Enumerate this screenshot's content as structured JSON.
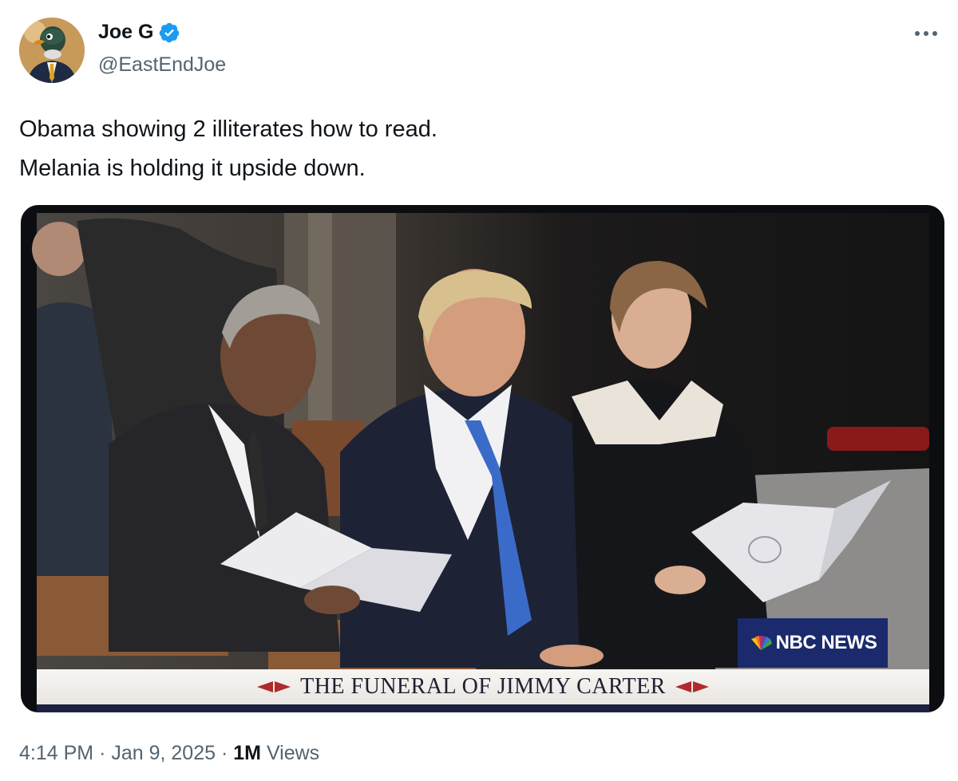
{
  "author": {
    "display_name": "Joe G",
    "handle": "@EastEndJoe",
    "verified": true,
    "avatar_icon": "duck-in-suit-avatar"
  },
  "tweet": {
    "lines": [
      "Obama showing 2 illiterates how to read.",
      "Melania is holding it upside down."
    ]
  },
  "media": {
    "channel_bug": "NBC NEWS",
    "caption": "THE FUNERAL OF JIMMY CARTER"
  },
  "meta": {
    "time": "4:14 PM",
    "separator": "·",
    "date": "Jan 9, 2025",
    "views_count": "1M",
    "views_label": "Views"
  },
  "colors": {
    "verified": "#1d9bf0",
    "text": "#0f1419",
    "secondary": "#536471",
    "nbc_blue": "#1a2a6c"
  },
  "icons": {
    "more": "more-dots-icon",
    "verified": "verified-badge-icon"
  }
}
